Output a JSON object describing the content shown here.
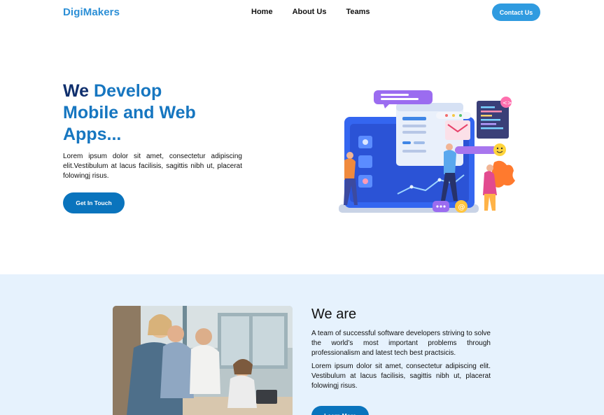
{
  "nav": {
    "logo": "DigiMakers",
    "links": [
      "Home",
      "About Us",
      "Teams"
    ],
    "contact_label": "Contact Us"
  },
  "hero": {
    "title_dark": "We",
    "title_accent_1": "Develop",
    "title_accent_2": "Mobile and Web",
    "title_accent_3": "Apps...",
    "text": "Lorem ipsum dolor sit amet, consectetur adipiscing elit.Vestibulum at lacus facilisis, sagittis nibh ut, placerat folowingj risus.",
    "button_label": "Get In Touch",
    "illustration_icon": "web-development-illustration"
  },
  "about": {
    "title": "We are",
    "text1": "A team of successful software developers striving to solve the world’s most important problems through professionalism and latest tech best practsicis.",
    "text2": "Lorem ipsum dolor sit amet, consectetur adipiscing elit. Vestibulum at lacus facilisis, sagittis nibh ut, placerat folowingj risus.",
    "button_label": "Learn More",
    "photo_icon": "team-photo"
  },
  "colors": {
    "brand": "#2c8fd6",
    "dark_blue": "#0f2f6d",
    "button_blue": "#0a74bd",
    "band_bg": "#e6f2fd"
  }
}
